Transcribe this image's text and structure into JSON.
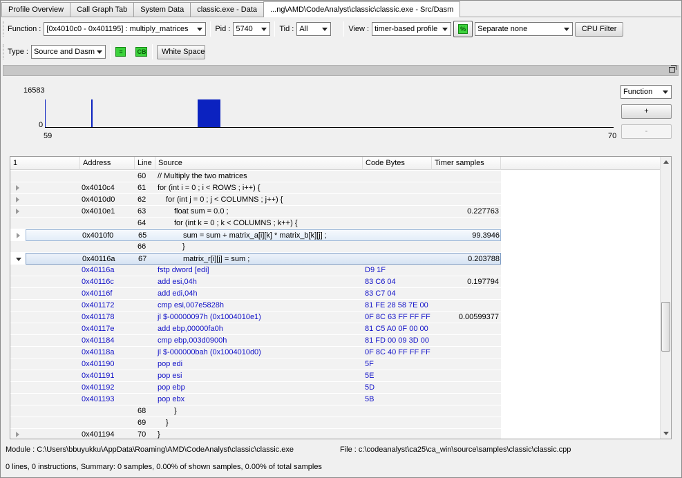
{
  "tabs": [
    {
      "label": "Profile Overview",
      "active": false
    },
    {
      "label": "Call Graph Tab",
      "active": false
    },
    {
      "label": "System Data",
      "active": false
    },
    {
      "label": "classic.exe - Data",
      "active": false
    },
    {
      "label": "...ng\\AMD\\CodeAnalyst\\classic\\classic.exe - Src/Dasm",
      "active": true
    }
  ],
  "toolbar1": {
    "function_label": "Function :",
    "function_value": "[0x4010c0 - 0x401195] : multiply_matrices",
    "pid_label": "Pid :",
    "pid_value": "5740",
    "tid_label": "Tid :",
    "tid_value": "All",
    "view_label": "View :",
    "view_value": "timer-based profile",
    "separate_value": "Separate none",
    "cpu_filter_label": "CPU Filter"
  },
  "toolbar2": {
    "type_label": "Type :",
    "type_value": "Source and Dasm",
    "cb_icon_text": "CB",
    "whitespace_label": "White Space"
  },
  "histogram": {
    "y_max_label": "16583",
    "y_min_label": "0",
    "x_min_label": "59",
    "x_max_label": "70",
    "side_combo_value": "Function",
    "zoom_in_label": "+",
    "zoom_out_label": "-"
  },
  "chart_data": {
    "type": "bar",
    "xlim": [
      59,
      70
    ],
    "ylim": [
      0,
      16583
    ],
    "bars": [
      {
        "x": 59.0,
        "width": 0.02,
        "value": 16583
      },
      {
        "x": 59.9,
        "width": 0.02,
        "value": 16583
      },
      {
        "x": 61.95,
        "width": 0.45,
        "value": 16583
      }
    ],
    "color": "#0b22c0"
  },
  "table": {
    "headers": [
      "1",
      "Address",
      "Line",
      "Source",
      "Code Bytes",
      "Timer samples"
    ],
    "rows": [
      {
        "expander": "",
        "address": "",
        "line": "60",
        "source": "// Multiply the two matrices",
        "bytes": "",
        "samples": "",
        "indent": 0,
        "asm": false,
        "sel": ""
      },
      {
        "expander": "closed",
        "address": "0x4010c4",
        "line": "61",
        "source": "for (int i = 0 ; i < ROWS ; i++) {",
        "bytes": "",
        "samples": "",
        "indent": 0,
        "asm": false,
        "sel": ""
      },
      {
        "expander": "closed",
        "address": "0x4010d0",
        "line": "62",
        "source": "for (int j = 0 ; j < COLUMNS ; j++) {",
        "bytes": "",
        "samples": "",
        "indent": 1,
        "asm": false,
        "sel": ""
      },
      {
        "expander": "closed",
        "address": "0x4010e1",
        "line": "63",
        "source": "float sum = 0.0 ;",
        "bytes": "",
        "samples": "0.227763",
        "indent": 2,
        "asm": false,
        "sel": ""
      },
      {
        "expander": "",
        "address": "",
        "line": "64",
        "source": "for (int k = 0 ; k < COLUMNS ; k++) {",
        "bytes": "",
        "samples": "",
        "indent": 2,
        "asm": false,
        "sel": ""
      },
      {
        "expander": "closed",
        "address": "0x4010f0",
        "line": "65",
        "source": "sum = sum + matrix_a[i][k] * matrix_b[k][j] ;",
        "bytes": "",
        "samples": "99.3946",
        "indent": 3,
        "asm": false,
        "sel": "light"
      },
      {
        "expander": "",
        "address": "",
        "line": "66",
        "source": "}",
        "bytes": "",
        "samples": "",
        "indent": 3,
        "asm": false,
        "sel": ""
      },
      {
        "expander": "open",
        "address": "0x40116a",
        "line": "67",
        "source": "matrix_r[i][j] = sum ;",
        "bytes": "",
        "samples": "0.203788",
        "indent": 3,
        "asm": false,
        "sel": "strong"
      },
      {
        "expander": "",
        "address": "0x40116a",
        "line": "",
        "source": "fstp dword [edi]",
        "bytes": "D9 1F",
        "samples": "",
        "indent": 0,
        "asm": true,
        "sel": ""
      },
      {
        "expander": "",
        "address": "0x40116c",
        "line": "",
        "source": "add esi,04h",
        "bytes": "83 C6 04",
        "samples": "0.197794",
        "indent": 0,
        "asm": true,
        "sel": ""
      },
      {
        "expander": "",
        "address": "0x40116f",
        "line": "",
        "source": "add edi,04h",
        "bytes": "83 C7 04",
        "samples": "",
        "indent": 0,
        "asm": true,
        "sel": ""
      },
      {
        "expander": "",
        "address": "0x401172",
        "line": "",
        "source": "cmp esi,007e5828h",
        "bytes": "81 FE 28 58 7E 00",
        "samples": "",
        "indent": 0,
        "asm": true,
        "sel": ""
      },
      {
        "expander": "",
        "address": "0x401178",
        "line": "",
        "source": "jl $-00000097h (0x1004010e1)",
        "bytes": "0F 8C 63 FF FF FF",
        "samples": "0.00599377",
        "indent": 0,
        "asm": true,
        "sel": ""
      },
      {
        "expander": "",
        "address": "0x40117e",
        "line": "",
        "source": "add ebp,00000fa0h",
        "bytes": "81 C5 A0 0F 00 00",
        "samples": "",
        "indent": 0,
        "asm": true,
        "sel": ""
      },
      {
        "expander": "",
        "address": "0x401184",
        "line": "",
        "source": "cmp ebp,003d0900h",
        "bytes": "81 FD 00 09 3D 00",
        "samples": "",
        "indent": 0,
        "asm": true,
        "sel": ""
      },
      {
        "expander": "",
        "address": "0x40118a",
        "line": "",
        "source": "jl $-000000bah (0x1004010d0)",
        "bytes": "0F 8C 40 FF FF FF",
        "samples": "",
        "indent": 0,
        "asm": true,
        "sel": ""
      },
      {
        "expander": "",
        "address": "0x401190",
        "line": "",
        "source": "pop edi",
        "bytes": "5F",
        "samples": "",
        "indent": 0,
        "asm": true,
        "sel": ""
      },
      {
        "expander": "",
        "address": "0x401191",
        "line": "",
        "source": "pop esi",
        "bytes": "5E",
        "samples": "",
        "indent": 0,
        "asm": true,
        "sel": ""
      },
      {
        "expander": "",
        "address": "0x401192",
        "line": "",
        "source": "pop ebp",
        "bytes": "5D",
        "samples": "",
        "indent": 0,
        "asm": true,
        "sel": ""
      },
      {
        "expander": "",
        "address": "0x401193",
        "line": "",
        "source": "pop ebx",
        "bytes": "5B",
        "samples": "",
        "indent": 0,
        "asm": true,
        "sel": ""
      },
      {
        "expander": "",
        "address": "",
        "line": "68",
        "source": "}",
        "bytes": "",
        "samples": "",
        "indent": 2,
        "asm": false,
        "sel": ""
      },
      {
        "expander": "",
        "address": "",
        "line": "69",
        "source": "}",
        "bytes": "",
        "samples": "",
        "indent": 1,
        "asm": false,
        "sel": ""
      },
      {
        "expander": "closed",
        "address": "0x401194",
        "line": "70",
        "source": "}",
        "bytes": "",
        "samples": "",
        "indent": 0,
        "asm": false,
        "sel": ""
      }
    ]
  },
  "footer": {
    "module": "Module : C:\\Users\\bbuyukku\\AppData\\Roaming\\AMD\\CodeAnalyst\\classic\\classic.exe",
    "file": "File : c:\\codeanalyst\\ca25\\ca_win\\source\\samples\\classic\\classic.cpp",
    "summary": "0 lines, 0 instructions, Summary: 0 samples, 0.00% of shown samples, 0.00% of total samples"
  }
}
